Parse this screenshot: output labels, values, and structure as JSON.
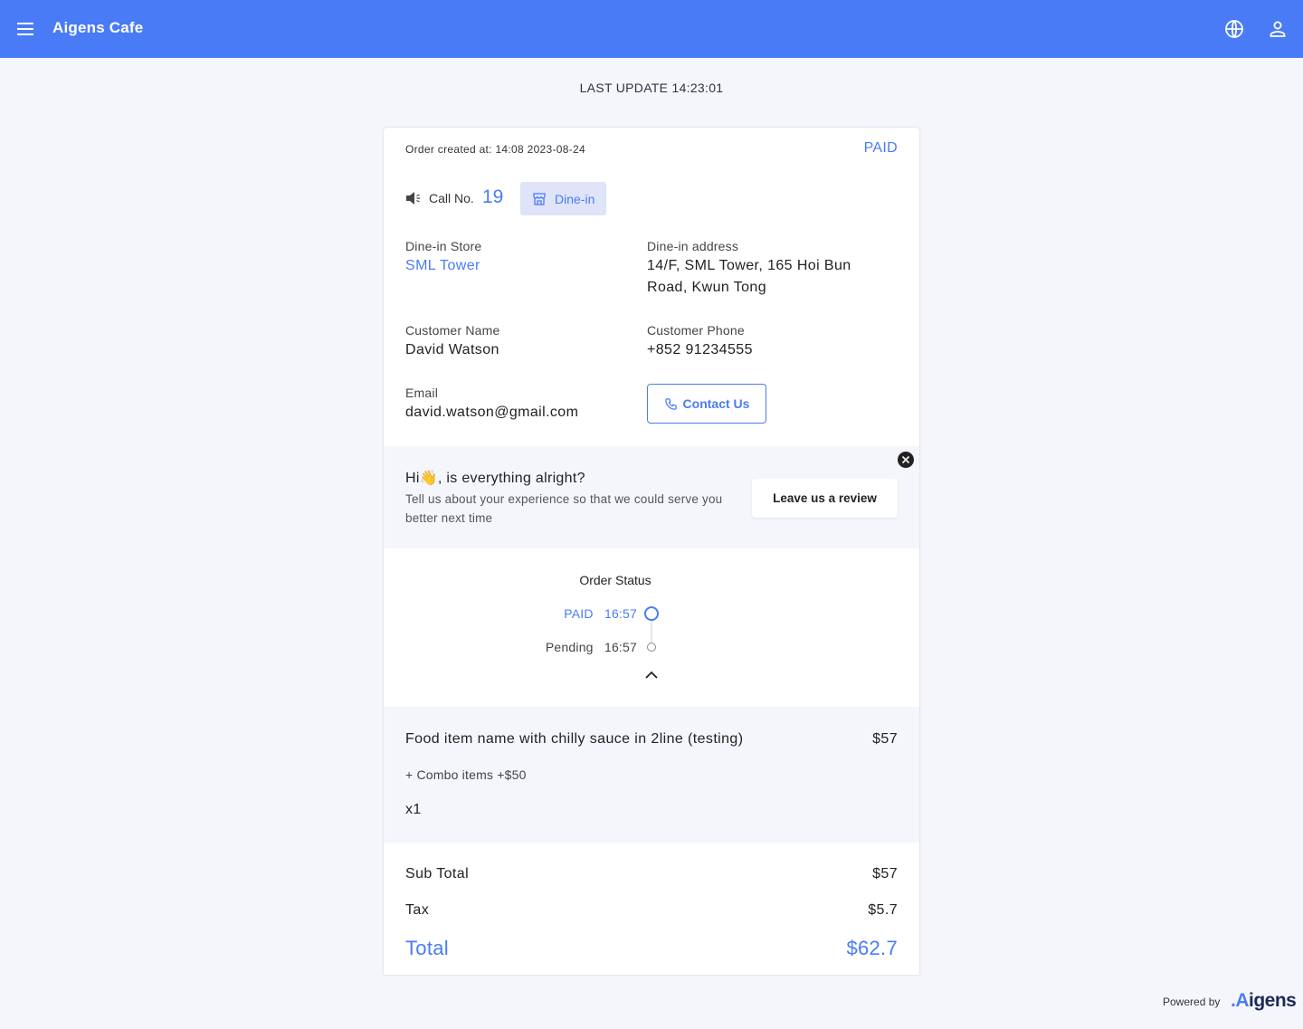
{
  "header": {
    "title": "Aigens Cafe"
  },
  "last_update": "LAST UPDATE 14:23:01",
  "order": {
    "created": "Order created at: 14:08 2023-08-24",
    "status": "PAID",
    "call_no_label": "Call No.",
    "call_no": "19",
    "service_type": "Dine-in",
    "store_label": "Dine-in Store",
    "store": "SML Tower",
    "address_label": "Dine-in address",
    "address_line1": "14/F, SML Tower, 165 Hoi Bun",
    "address_line2": "Road, Kwun Tong",
    "customer_name_label": "Customer Name",
    "customer_name": "David Watson",
    "customer_phone_label": "Customer Phone",
    "customer_phone": "+852 91234555",
    "email_label": "Email",
    "email": "david.watson@gmail.com",
    "contact_label": "Contact Us"
  },
  "review": {
    "title": "Hi👋, is everything alright?",
    "text": "Tell us about your experience so that we could serve you better next time",
    "button": "Leave us a review"
  },
  "order_status": {
    "title": "Order Status",
    "steps": [
      {
        "label": "PAID",
        "time": "16:57",
        "active": true
      },
      {
        "label": "Pending",
        "time": "16:57",
        "active": false
      }
    ]
  },
  "items": [
    {
      "name": "Food item name with chilly sauce in 2line (testing)",
      "price": "$57",
      "combo": "+ Combo items +$50",
      "qty": "x1"
    }
  ],
  "summary": {
    "subtotal_label": "Sub Total",
    "subtotal": "$57",
    "tax_label": "Tax",
    "tax": "$5.7",
    "total_label": "Total",
    "total": "$62.7"
  },
  "footer": {
    "powered_by": "Powered by",
    "brand_prefix": ".A",
    "brand_suffix": "igens"
  },
  "colors": {
    "accent": "#4a7bf7",
    "background": "#f5f6fc",
    "chip": "#dfe4f8"
  },
  "icons": {
    "menu": "menu-icon",
    "language": "globe-icon",
    "account": "user-icon",
    "call": "speaker-icon",
    "dine_in": "store-icon",
    "phone": "phone-icon",
    "close": "close-icon",
    "collapse": "chevron-up-icon"
  }
}
